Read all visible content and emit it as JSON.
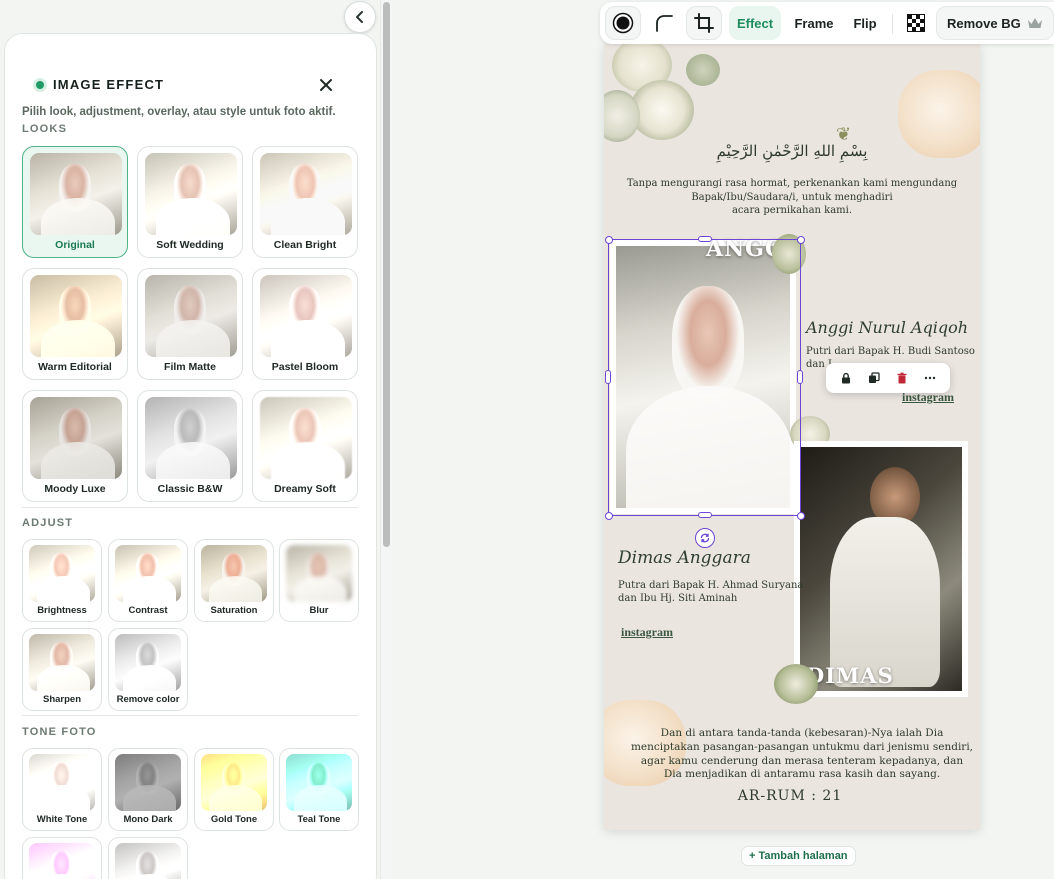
{
  "panel": {
    "title": "IMAGE EFFECT",
    "subtitle": "Pilih look, adjustment, overlay, atau style untuk foto aktif.",
    "looks_label": "LOOKS",
    "adjust_label": "ADJUST",
    "tone_label": "TONE FOTO",
    "looks": [
      {
        "label": "Original"
      },
      {
        "label": "Soft Wedding"
      },
      {
        "label": "Clean Bright"
      },
      {
        "label": "Warm Editorial"
      },
      {
        "label": "Film Matte"
      },
      {
        "label": "Pastel Bloom"
      },
      {
        "label": "Moody Luxe"
      },
      {
        "label": "Classic B&W"
      },
      {
        "label": "Dreamy Soft"
      }
    ],
    "selected_look": "Original",
    "adjust": [
      {
        "label": "Brightness"
      },
      {
        "label": "Contrast"
      },
      {
        "label": "Saturation"
      },
      {
        "label": "Blur"
      },
      {
        "label": "Sharpen"
      },
      {
        "label": "Remove color"
      }
    ],
    "tones": [
      {
        "label": "White Tone"
      },
      {
        "label": "Mono Dark"
      },
      {
        "label": "Gold Tone"
      },
      {
        "label": "Teal Tone"
      },
      {
        "label": ""
      },
      {
        "label": ""
      }
    ]
  },
  "toolbar": {
    "effect_label": "Effect",
    "frame_label": "Frame",
    "flip_label": "Flip",
    "remove_bg_label": "Remove BG",
    "icons": [
      "circle-mask-icon",
      "corner-radius-icon",
      "crop-icon",
      "transparency-icon",
      "crown-icon"
    ]
  },
  "invitation": {
    "bismillah": "بِسْمِ اللهِ الرَّحْمٰنِ الرَّحِيْمِ",
    "opening_line1": "Tanpa mengurangi rasa hormat, perkenankan kami mengundang",
    "opening_line2": "Bapak/Ibu/Saudara/i, untuk menghadiri",
    "opening_line3": "acara pernikahan kami.",
    "bride_stamp_name": "ANGGI",
    "bride_name": "Anggi Nurul Aqiqoh",
    "bride_parents_line1": "Putri dari Bapak H. Budi Santoso",
    "bride_parents_line2": "dan I",
    "bride_instagram": "instagram",
    "groom_name": "Dimas Anggara",
    "groom_parents_line1": "Putra dari Bapak H. Ahmad Suryana",
    "groom_parents_line2": "dan Ibu Hj. Siti Aminah",
    "groom_instagram": "instagram",
    "groom_stamp_name": "DIMAS",
    "verse_line1": "Dan di antara tanda-tanda (kebesaran)-Nya ialah Dia",
    "verse_line2": "menciptakan pasangan-pasangan untukmu dari jenismu sendiri,",
    "verse_line3": "agar kamu cenderung dan merasa tenteram kepadanya, dan",
    "verse_line4": "Dia menjadikan di antaramu rasa kasih dan sayang.",
    "verse_ref": "AR-RUM : 21"
  },
  "add_page_label": "Tambah halaman",
  "colors": {
    "accent": "#1e9a66",
    "selection": "#6b45d6",
    "page_bg": "#ebe5e0",
    "delete": "#c0283a"
  }
}
